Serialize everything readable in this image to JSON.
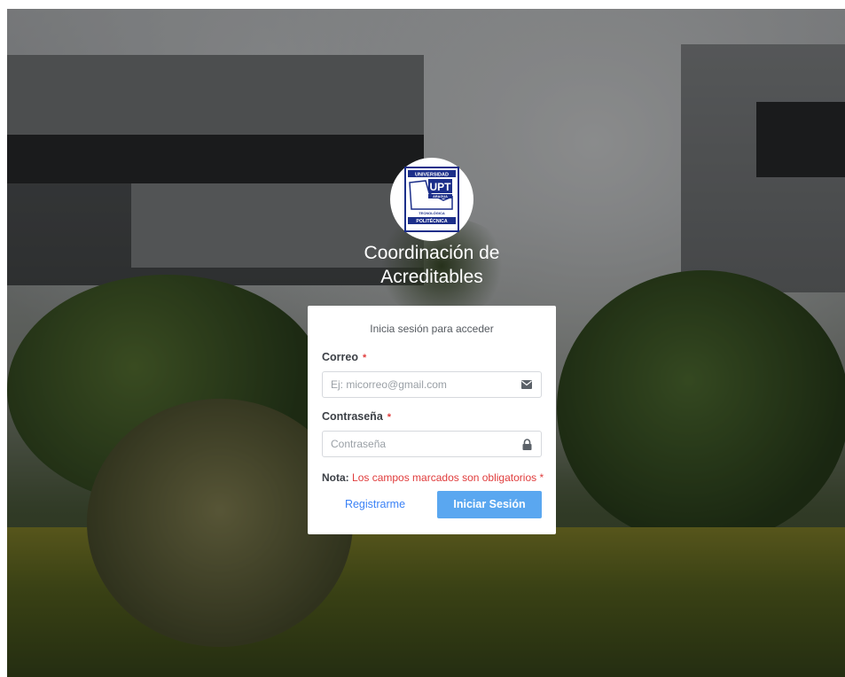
{
  "header": {
    "logo": {
      "icon": "upt-university-logo",
      "text_lines": [
        "UNIVERSIDAD",
        "UPT",
        "ARAGUA",
        "TECNOLÓGICA",
        "POLITÉCNICA"
      ]
    },
    "title": "Coordinación de Acreditables"
  },
  "login": {
    "subtitle": "Inicia sesión para acceder",
    "email": {
      "label": "Correo",
      "required_mark": "*",
      "placeholder": "Ej: micorreo@gmail.com",
      "value": "",
      "icon": "envelope-icon"
    },
    "password": {
      "label": "Contraseña",
      "required_mark": "*",
      "placeholder": "Contraseña",
      "value": "",
      "icon": "lock-icon"
    },
    "note": {
      "prefix": "Nota:",
      "text": "Los campos marcados son obligatorios",
      "mark": "*"
    },
    "register_label": "Registrarme",
    "submit_label": "Iniciar Sesión"
  },
  "colors": {
    "primary": "#5aa7f0",
    "link": "#3b82f6",
    "required": "#e03c3c"
  }
}
